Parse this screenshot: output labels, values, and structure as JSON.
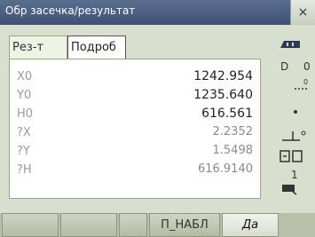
{
  "window": {
    "title": "Обр засечка/результат",
    "close_label": "×"
  },
  "tabs": [
    {
      "label": "Рез-т"
    },
    {
      "label": "Подроб"
    }
  ],
  "results": [
    {
      "label": "X0",
      "value": "1242.954"
    },
    {
      "label": "Y0",
      "value": "1235.640"
    },
    {
      "label": "H0",
      "value": "616.561"
    },
    {
      "label": "?X",
      "value": "2.2352"
    },
    {
      "label": "?Y",
      "value": "1.5498"
    },
    {
      "label": "?H",
      "value": "616.9140"
    }
  ],
  "side_icons": {
    "battery": "battery-icon",
    "face": "D",
    "zero": "0",
    "target": "target-icon",
    "level": "level-icon",
    "mode": "mode-icon",
    "page_label": "1",
    "keyboard": "keyboard-icon"
  },
  "function_keys": [
    {
      "label": ""
    },
    {
      "label": ""
    },
    {
      "label": ""
    },
    {
      "label": "П_НАБЛ"
    },
    {
      "label": "Да"
    }
  ]
}
